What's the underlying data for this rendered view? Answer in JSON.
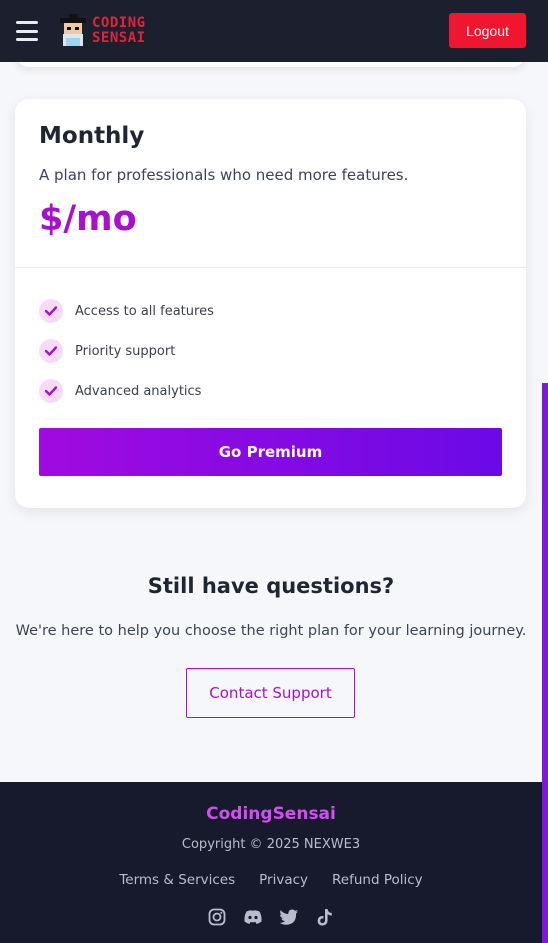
{
  "header": {
    "logo_line1": "CODING",
    "logo_line2": "SENSAI",
    "logout_label": "Logout"
  },
  "plan": {
    "title": "Monthly",
    "description": "A plan for professionals who need more features.",
    "price": "$/mo",
    "features": [
      "Access to all features",
      "Priority support",
      "Advanced analytics"
    ],
    "cta_label": "Go Premium"
  },
  "questions": {
    "title": "Still have questions?",
    "description": "We're here to help you choose the right plan for your learning journey.",
    "contact_label": "Contact Support"
  },
  "footer": {
    "brand": "CodingSensai",
    "copyright": "Copyright © 2025 NEXWE3",
    "links": [
      "Terms & Services",
      "Privacy",
      "Refund Policy"
    ],
    "socials": [
      "instagram-icon",
      "discord-icon",
      "twitter-icon",
      "tiktok-icon"
    ]
  },
  "colors": {
    "accent": "#a80fcf",
    "logout": "#f0162f",
    "nav_bg": "#1b1f2e",
    "footer_bg": "#161a2c"
  }
}
